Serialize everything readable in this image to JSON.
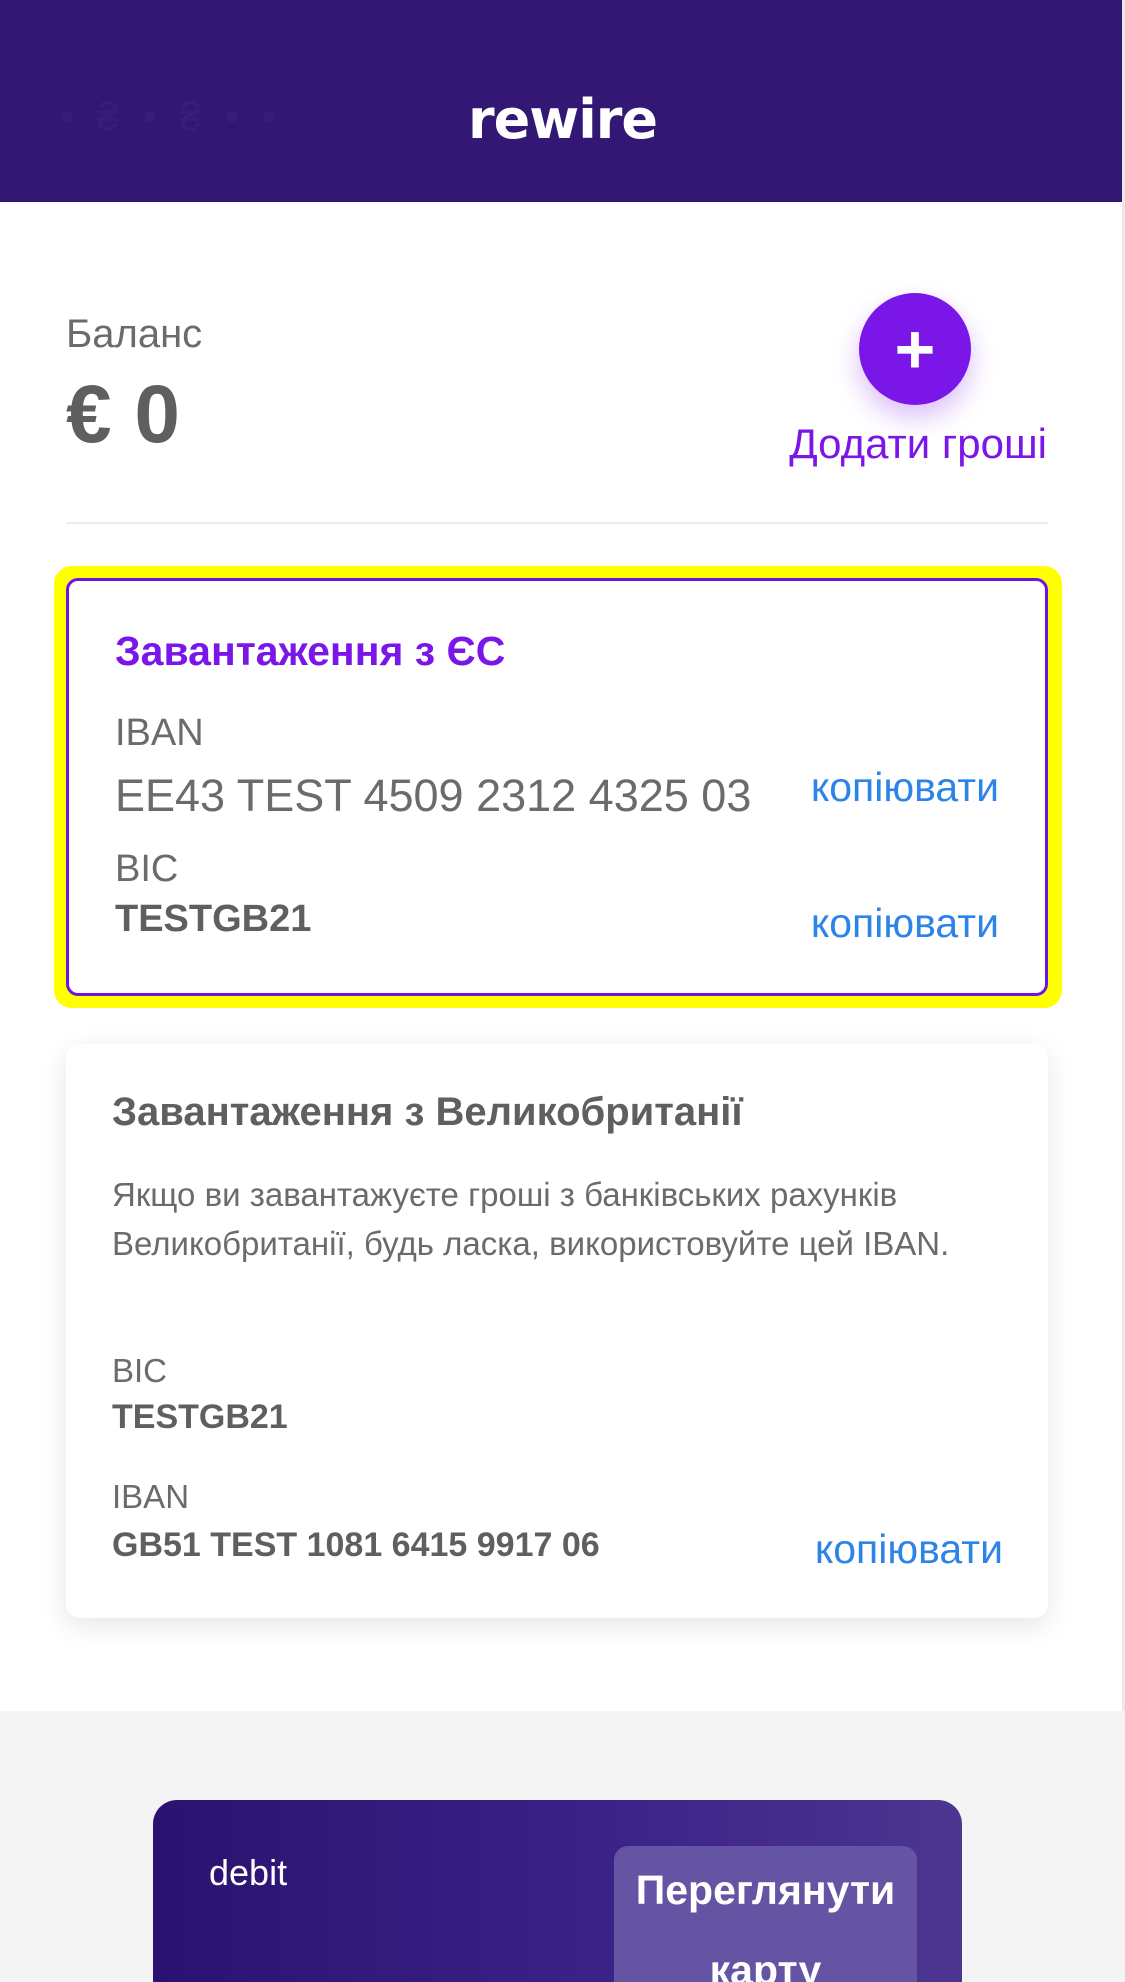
{
  "header": {
    "logo_text": "rewire",
    "ghost_text": "• ₴ • ₴ • •"
  },
  "balance": {
    "label": "Баланс",
    "value": "€ 0",
    "add_money_label": "Додати гроші",
    "add_icon": "+"
  },
  "eu_card": {
    "title": "Завантаження з ЄС",
    "iban_label": "IBAN",
    "iban_value": "EE43 TEST 4509 2312 4325 03",
    "iban_copy": "копіювати",
    "bic_label": "BIC",
    "bic_value": "TESTGB21",
    "bic_copy": "копіювати"
  },
  "uk_card": {
    "title": "Завантаження з Великобританії",
    "description": "Якщо ви завантажуєте гроші з банківських рахунків Великобританії, будь ласка, використовуйте цей IBAN.",
    "bic_label": "BIC",
    "bic_value": "TESTGB21",
    "iban_label": "IBAN",
    "iban_value": "GB51 TEST 1081 6415 9917 06",
    "iban_copy": "копіювати"
  },
  "debit_card": {
    "label": "debit",
    "view_button": "Переглянути карту"
  },
  "colors": {
    "header_bg": "#321874",
    "accent_purple": "#7b16e8",
    "link_blue": "#2d84e8",
    "highlight": "#ffff00"
  }
}
